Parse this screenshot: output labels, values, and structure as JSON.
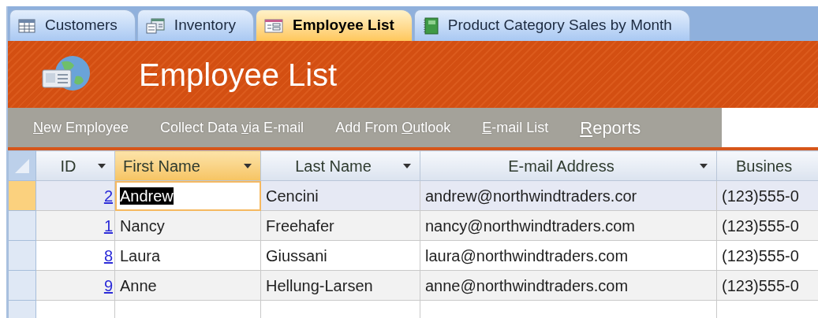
{
  "tabs": [
    {
      "label": "Customers",
      "kind": "table",
      "selected": false
    },
    {
      "label": "Inventory",
      "kind": "form",
      "selected": false
    },
    {
      "label": "Employee List",
      "kind": "list",
      "selected": true
    },
    {
      "label": "Product Category Sales by Month",
      "kind": "report",
      "selected": false
    }
  ],
  "header": {
    "title": "Employee List"
  },
  "toolbar": [
    {
      "kind": "command",
      "key": "N",
      "post": "ew Employee"
    },
    {
      "kind": "command",
      "pre": "Collect Data ",
      "key": "v",
      "post": "ia E-mail"
    },
    {
      "kind": "command",
      "pre": "Add From ",
      "key": "O",
      "post": "utlook"
    },
    {
      "kind": "command",
      "key": "E",
      "post": "-mail List"
    },
    {
      "kind": "menu",
      "key": "R",
      "post": "eports"
    }
  ],
  "table": {
    "columns": [
      {
        "label": "ID",
        "filter": true,
        "selected": false
      },
      {
        "label": "First Name",
        "filter": true,
        "selected": true
      },
      {
        "label": "Last Name",
        "filter": true,
        "selected": false
      },
      {
        "label": "E-mail Address",
        "filter": true,
        "selected": false
      },
      {
        "label": "Busines",
        "selected": false
      }
    ],
    "rows": [
      {
        "selected": true,
        "editing": true,
        "cells": [
          "2",
          "Andrew",
          "Cencini",
          "andrew@northwindtraders.cor",
          "(123)555-0"
        ]
      },
      {
        "selected": false,
        "editing": false,
        "cells": [
          "1",
          "Nancy",
          "Freehafer",
          "nancy@northwindtraders.com",
          "(123)555-0"
        ]
      },
      {
        "selected": false,
        "editing": false,
        "cells": [
          "8",
          "Laura",
          "Giussani",
          "laura@northwindtraders.com",
          "(123)555-0"
        ]
      },
      {
        "selected": false,
        "editing": false,
        "cells": [
          "9",
          "Anne",
          "Hellung-Larsen",
          "anne@northwindtraders.com",
          "(123)555-0"
        ]
      }
    ]
  }
}
